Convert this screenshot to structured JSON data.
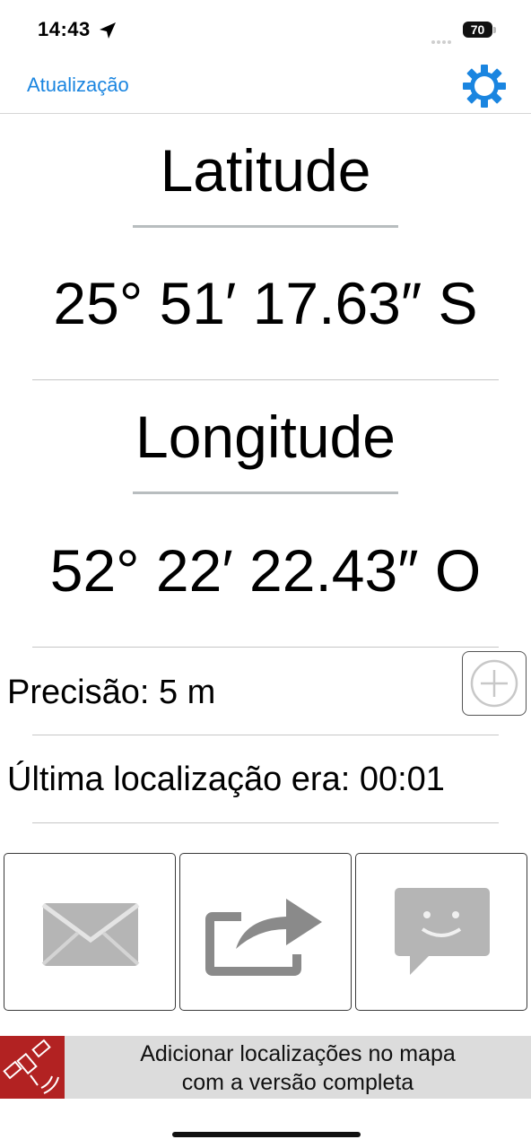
{
  "status_bar": {
    "time": "14:43",
    "battery": "70"
  },
  "nav": {
    "refresh_label": "Atualização"
  },
  "latitude": {
    "heading": "Latitude",
    "value": "25° 51′ 17.63″ S"
  },
  "longitude": {
    "heading": "Longitude",
    "value": "52° 22′ 22.43″ O"
  },
  "info": {
    "precision": "Precisão: 5 m",
    "last_location": "Última localização era: 00:01"
  },
  "actions": [
    {
      "icon": "envelope-icon"
    },
    {
      "icon": "share-icon"
    },
    {
      "icon": "message-icon"
    }
  ],
  "banner": {
    "line1": "Adicionar localizações no mapa",
    "line2": "com a versão completa"
  },
  "colors": {
    "accent": "#1a85e0",
    "banner_icon_bg": "#b22222",
    "banner_bg": "#dcdcdc"
  }
}
